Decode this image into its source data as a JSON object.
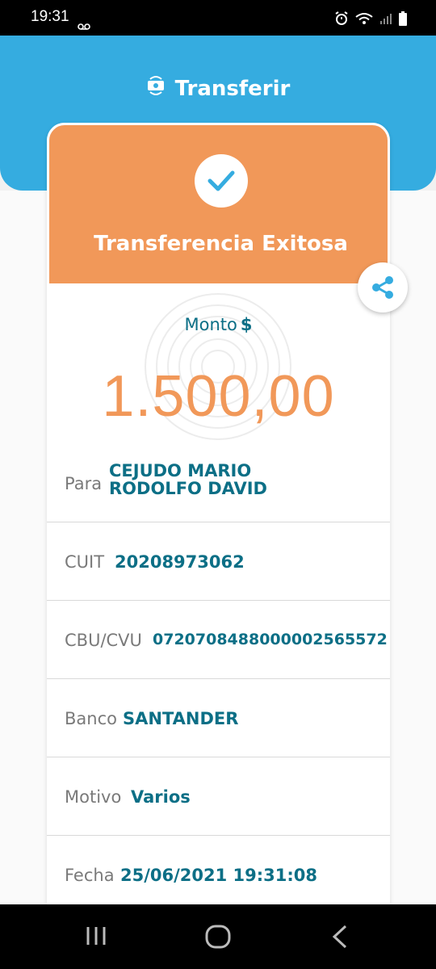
{
  "status_bar": {
    "time": "19:31",
    "icons": [
      "voicemail-icon",
      "alarm-icon",
      "wifi-icon",
      "signal-icon",
      "battery-icon"
    ]
  },
  "header": {
    "icon": "transfer-icon",
    "title": "Transferir"
  },
  "result": {
    "icon": "check-icon",
    "title": "Transferencia Exitosa"
  },
  "amount": {
    "label": "Monto",
    "currency": "$",
    "value": "1.500,00"
  },
  "details": [
    {
      "label": "Para",
      "value": "CEJUDO MARIO RODOLFO DAVID"
    },
    {
      "label": "CUIT",
      "value": "20208973062"
    },
    {
      "label": "CBU/CVU",
      "value": "0720708488000002565572"
    },
    {
      "label": "Banco",
      "value": "SANTANDER"
    },
    {
      "label": "Motivo",
      "value": "Varios"
    },
    {
      "label": "Fecha",
      "value": "25/06/2021 19:31:08"
    }
  ],
  "share": {
    "icon": "share-icon"
  },
  "colors": {
    "header_blue": "#35ace0",
    "success_orange": "#f19859",
    "value_teal": "#0c6f86"
  }
}
